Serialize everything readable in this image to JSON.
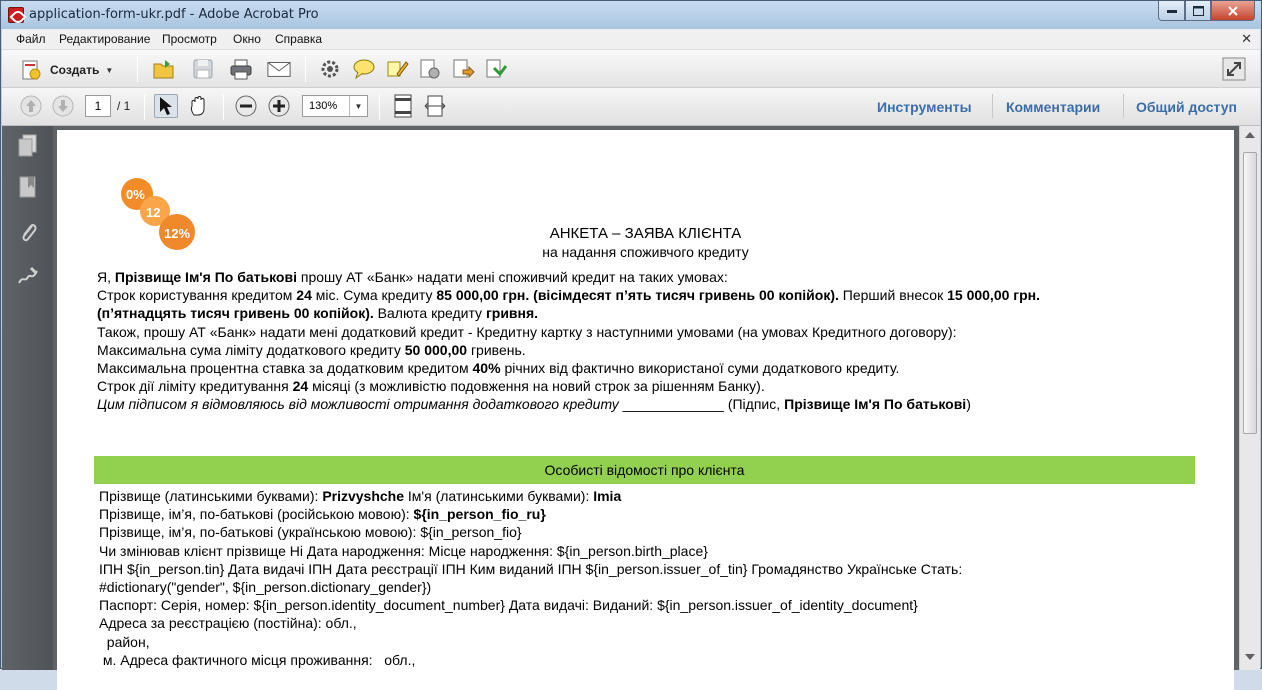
{
  "window": {
    "title": "application-form-ukr.pdf - Adobe Acrobat Pro"
  },
  "menubar": {
    "items": [
      "Файл",
      "Редактирование",
      "Просмотр",
      "Окно",
      "Справка"
    ]
  },
  "toolbar": {
    "create_label": "Создать",
    "page_current": "1",
    "page_total": "/ 1",
    "zoom": "130%",
    "panels": [
      "Инструменты",
      "Комментарии",
      "Общий доступ"
    ]
  },
  "document": {
    "logo_numbers": [
      "0%",
      "12",
      "12%"
    ],
    "title": "АНКЕТА – ЗАЯВА КЛІЄНТА",
    "subtitle": "на надання споживчого кредиту",
    "client_name": "Прізвище Ім'я По батькові",
    "intro_prefix": "Я,",
    "intro_suffix": "прошу АТ «Банк» надати мені споживчий кредит на таких умовах:",
    "term_prefix": "Строк користування кредитом",
    "term_value": "24",
    "term_unit": "міс. Сума кредиту",
    "amount_text": "85 000,00 грн. (вісімдесят п’ять тисяч гривень 00 копійок).",
    "down_payment_label": "Перший внесок",
    "down_payment_value": "15 000,00 грн.",
    "down_payment_words": "(п’ятнадцять тисяч гривень 00 копійок).",
    "currency_label": "Валюта кредиту",
    "currency_value": "гривня.",
    "additional_line": "Також, прошу АТ «Банк» надати мені додатковий кредит - Кредитну картку з наступними умовами (на умовах Кредитного договору):",
    "max_limit_label": "Максимальна сума ліміту додаткового кредиту",
    "max_limit_value": "50 000,00",
    "max_limit_unit": "гривень.",
    "rate_label": "Максимальна процентна ставка за додатковим кредитом",
    "rate_value": "40%",
    "rate_suffix": "річних від фактично використаної суми додаткового кредиту.",
    "limit_term_label": "Строк дії ліміту кредитування",
    "limit_term_value": "24",
    "limit_term_suffix": "місяці (з можливістю подовження на новий строк за рішенням Банку).",
    "refusal_text": "Цим підписом я відмовляюсь від можливості отримання додаткового кредиту",
    "signature_blank": "_____________",
    "signature_prefix": "(Підпис,",
    "signature_suffix": ")",
    "section_title": "Особисті відомості про клієнта",
    "personal": {
      "latin_surname_label": "Прізвище (латинськими буквами):",
      "latin_surname_value": "Prizvyshche",
      "latin_name_label": "Ім'я (латинськими буквами):",
      "latin_name_value": "Imia",
      "ru_fio_label": "Прізвище, ім’я, по-батькові (російською мовою):",
      "ru_fio_value": "${in_person_fio_ru}",
      "ua_fio_line": "Прізвище, ім’я, по-батькові (українською мовою): ${in_person_fio}",
      "birth_line": "Чи змінював клієнт прізвище Ні Дата народження:  Місце народження: ${in_person.birth_place}",
      "tin_line": "ІПН ${in_person.tin} Дата видачі ІПН  Дата реєстрації ІПН  Ким виданий ІПН ${in_person.issuer_of_tin} Громадянство Українське Стать:",
      "gender_line": "#dictionary(\"gender\", ${in_person.dictionary_gender})",
      "passport_line": "Паспорт: Серія, номер: ${in_person.identity_document_number} Дата видачі:  Виданий: ${in_person.issuer_of_identity_document}",
      "reg_address_line": "Адреса за реєстрацією (постійна):   обл.,",
      "district_line": "  район,",
      "actual_address_line": " м. Адреса фактичного місця проживання:   обл.,"
    }
  }
}
